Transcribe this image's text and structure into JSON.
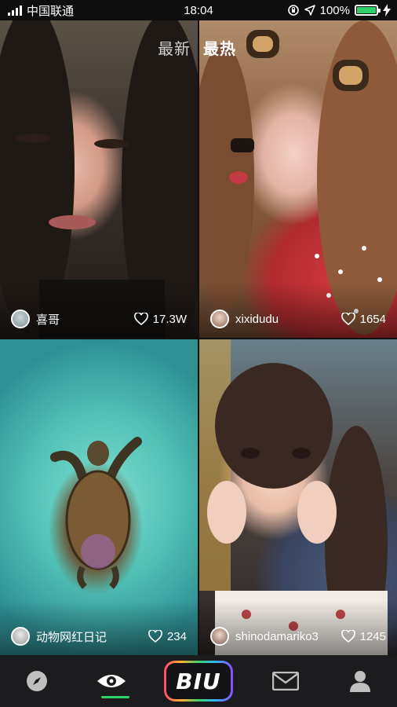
{
  "status_bar": {
    "carrier": "中国联通",
    "time": "18:04",
    "battery": "100%",
    "battery_level": 1.0
  },
  "tabs": {
    "new_label": "最新",
    "hot_label": "最热",
    "active": "最热"
  },
  "feed": [
    {
      "author": "喜哥",
      "likes": "17.3W"
    },
    {
      "author": "xixidudu",
      "likes": "1654"
    },
    {
      "author": "动物网红日记",
      "likes": "234"
    },
    {
      "author": "shinodamariko3",
      "likes": "1245"
    }
  ],
  "nav": {
    "logo_text": "BIU",
    "items": [
      "compass-icon",
      "eye-icon",
      "biu-logo",
      "mail-icon",
      "profile-icon"
    ],
    "active_item": "eye-icon",
    "active_color": "#2fd16a"
  }
}
